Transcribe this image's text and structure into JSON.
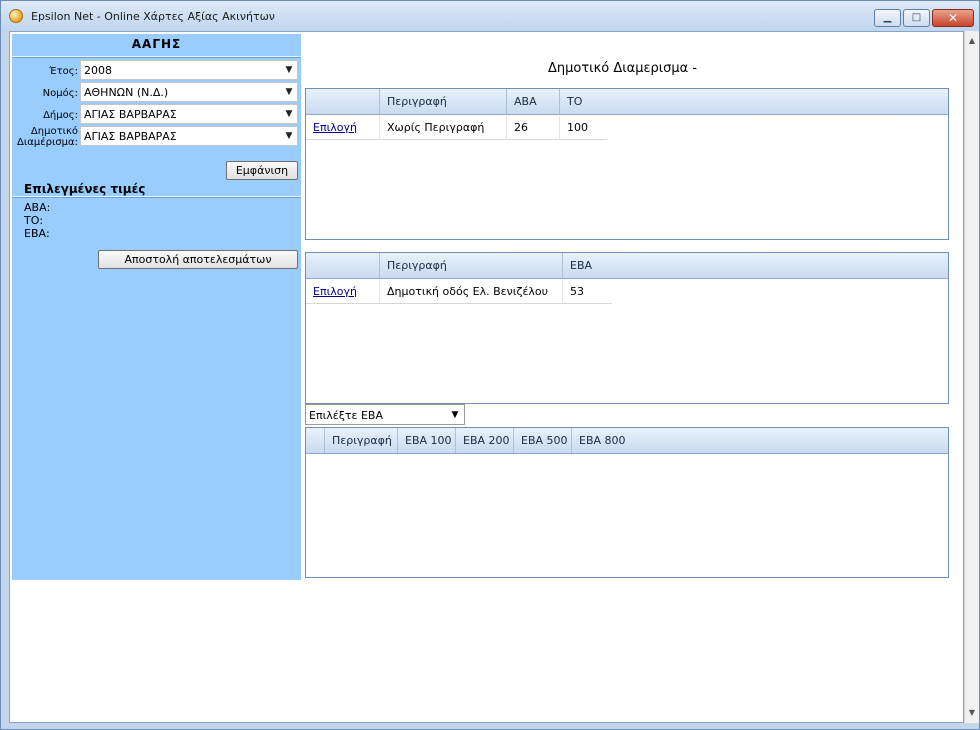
{
  "window": {
    "title": "Epsilon Net - Online Χάρτες Αξίας Ακινήτων"
  },
  "sidebar": {
    "title": "ΑΑΓΗΣ",
    "fields": [
      {
        "label": "Έτος:",
        "value": "2008"
      },
      {
        "label": "Νομός:",
        "value": "ΑΘΗΝΩΝ (Ν.Δ.)"
      },
      {
        "label": "Δήμος:",
        "value": "ΑΓΙΑΣ ΒΑΡΒΑΡΑΣ"
      },
      {
        "label_line1": "Δημοτικό",
        "label_line2": "Διαμέρισμα:",
        "value": "ΑΓΙΑΣ ΒΑΡΒΑΡΑΣ"
      }
    ],
    "show_button": "Εμφάνιση",
    "selected_title": "Επιλεγμένες τιμές",
    "selected": [
      "ΑΒΑ:",
      "ΤΟ:",
      "ΕΒΑ:"
    ],
    "send_button": "Αποστολή αποτελεσμάτων"
  },
  "main": {
    "title": "Δημοτικό Διαμερισμα -",
    "grid1": {
      "headers": [
        "",
        "Περιγραφή",
        "ΑΒΑ",
        "ΤΟ"
      ],
      "rows": [
        {
          "link": "Επιλογή",
          "desc": "Χωρίς Περιγραφή",
          "aba": "26",
          "to": "100"
        }
      ]
    },
    "grid2": {
      "headers": [
        "",
        "Περιγραφή",
        "ΕΒΑ"
      ],
      "rows": [
        {
          "link": "Επιλογή",
          "desc": "Δημοτική οδός Ελ. Βενιζέλου",
          "eba": "53"
        }
      ]
    },
    "eba_select": {
      "value": "Επιλέξτε ΕΒΑ"
    },
    "grid3": {
      "headers": [
        "",
        "Περιγραφή",
        "ΕΒΑ 100",
        "ΕΒΑ 200",
        "ΕΒΑ 500",
        "ΕΒΑ 800"
      ]
    }
  },
  "icons": {
    "dropdown": "chevron-down-icon",
    "scroll_up": "arrow-up-icon",
    "scroll_down": "arrow-down-icon"
  }
}
